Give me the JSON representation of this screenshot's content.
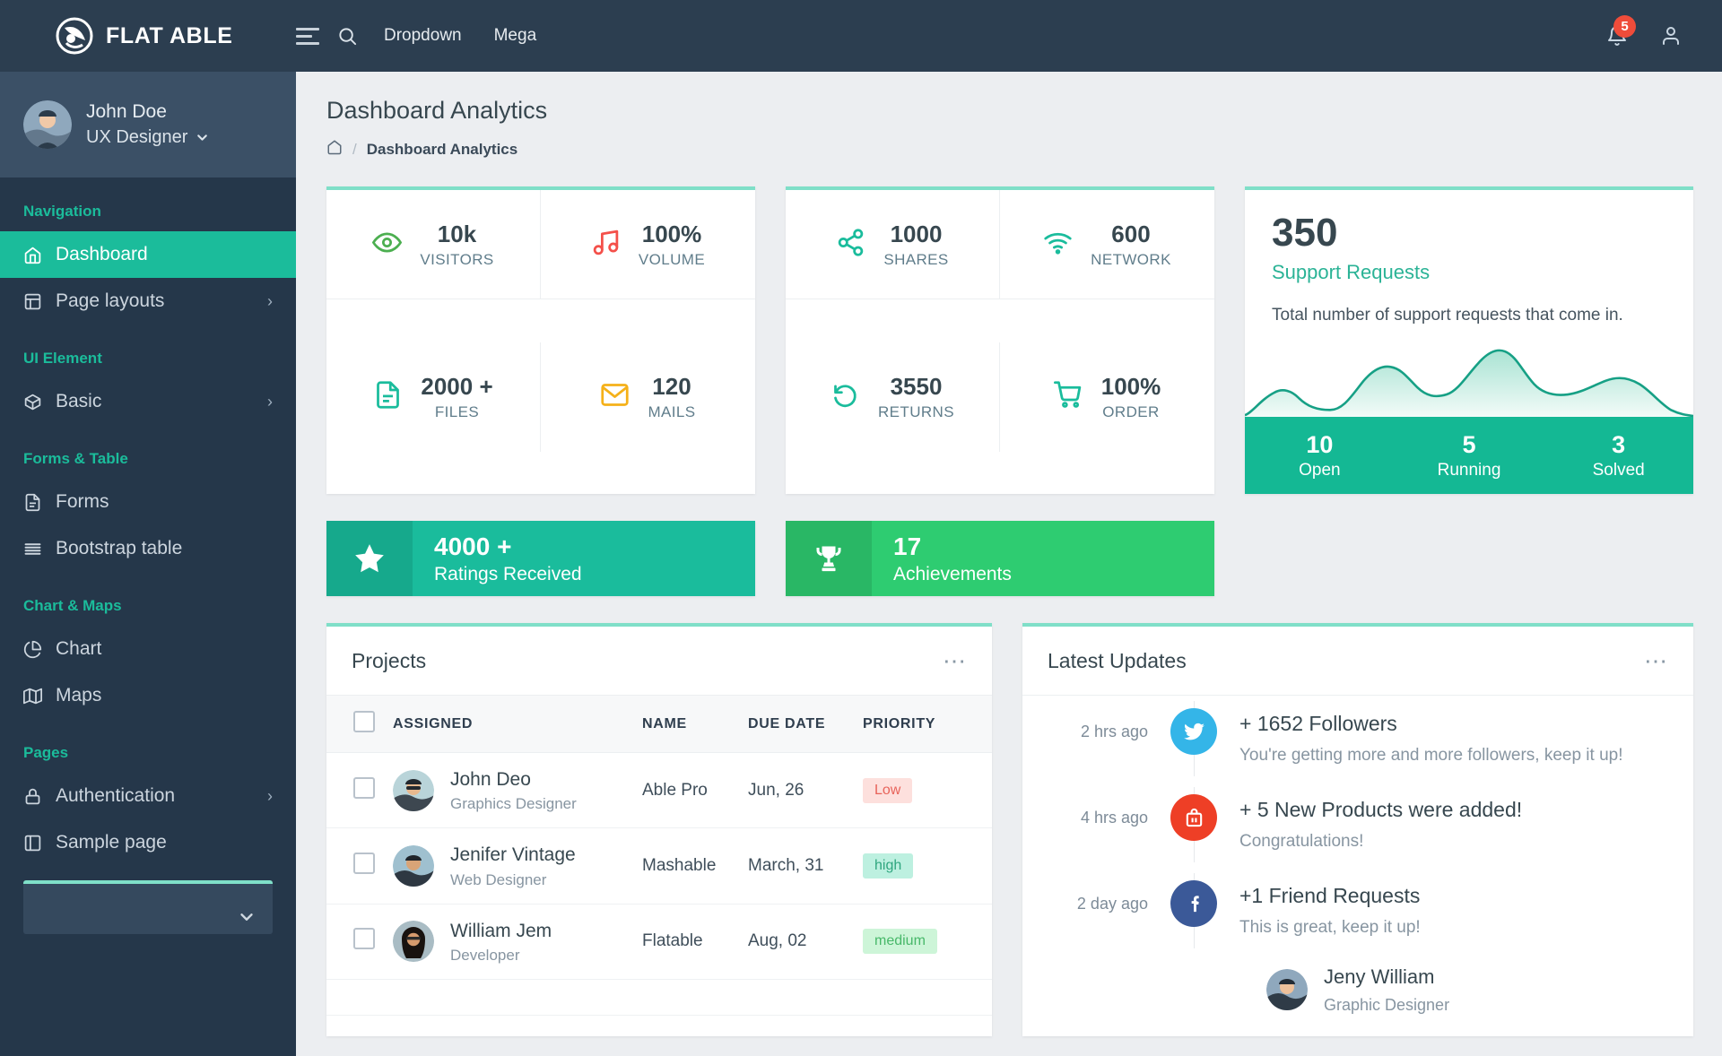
{
  "header": {
    "brand": "FLAT ABLE",
    "logo_icon": "globe-logo-icon",
    "menu_toggle_icon": "hamburger-icon",
    "search_icon": "search-icon",
    "links": [
      {
        "label": "Dropdown"
      },
      {
        "label": "Mega"
      }
    ],
    "notification_icon": "bell-icon",
    "notification_count": "5",
    "profile_icon": "user-icon"
  },
  "sidebar": {
    "user": {
      "name": "John Doe",
      "role": "UX Designer",
      "caret_icon": "chevron-down-icon",
      "avatar_icon": "avatar"
    },
    "groups": [
      {
        "caption": "Navigation",
        "items": [
          {
            "label": "Dashboard",
            "icon": "home-icon",
            "active": true,
            "arrow": ""
          },
          {
            "label": "Page layouts",
            "icon": "layout-icon",
            "active": false,
            "arrow": "›"
          }
        ]
      },
      {
        "caption": "UI Element",
        "items": [
          {
            "label": "Basic",
            "icon": "box-icon",
            "active": false,
            "arrow": "›"
          }
        ]
      },
      {
        "caption": "Forms & Table",
        "items": [
          {
            "label": "Forms",
            "icon": "file-text-icon",
            "active": false,
            "arrow": ""
          },
          {
            "label": "Bootstrap table",
            "icon": "list-icon",
            "active": false,
            "arrow": ""
          }
        ]
      },
      {
        "caption": "Chart & Maps",
        "items": [
          {
            "label": "Chart",
            "icon": "pie-chart-icon",
            "active": false,
            "arrow": ""
          },
          {
            "label": "Maps",
            "icon": "map-icon",
            "active": false,
            "arrow": ""
          }
        ]
      },
      {
        "caption": "Pages",
        "items": [
          {
            "label": "Authentication",
            "icon": "lock-icon",
            "active": false,
            "arrow": "›"
          },
          {
            "label": "Sample page",
            "icon": "sidebar-icon",
            "active": false,
            "arrow": ""
          }
        ]
      }
    ],
    "bottom_card": {
      "caret_icon": "chevron-down-icon"
    }
  },
  "page": {
    "title": "Dashboard Analytics",
    "breadcrumb": {
      "home_icon": "home-icon",
      "separator": "/",
      "current": "Dashboard Analytics"
    }
  },
  "stats_group_1": [
    {
      "value": "10k",
      "label": "VISITORS",
      "icon": "eye-icon",
      "color": "#4caf50"
    },
    {
      "value": "100%",
      "label": "VOLUME",
      "icon": "music-icon",
      "color": "#f4504a"
    },
    {
      "value": "2000 +",
      "label": "FILES",
      "icon": "file-icon",
      "color": "#1abc9c"
    },
    {
      "value": "120",
      "label": "MAILS",
      "icon": "mail-icon",
      "color": "#f5b119"
    }
  ],
  "stats_group_2": [
    {
      "value": "1000",
      "label": "SHARES",
      "icon": "share-icon",
      "color": "#1abc9c"
    },
    {
      "value": "600",
      "label": "NETWORK",
      "icon": "wifi-icon",
      "color": "#1abc9c"
    },
    {
      "value": "3550",
      "label": "RETURNS",
      "icon": "refresh-icon",
      "color": "#1abc9c"
    },
    {
      "value": "100%",
      "label": "ORDER",
      "icon": "cart-icon",
      "color": "#1abc9c"
    }
  ],
  "support": {
    "count": "350",
    "subtitle": "Support Requests",
    "description": "Total number of support requests that come in.",
    "footer": [
      {
        "value": "10",
        "label": "Open"
      },
      {
        "value": "5",
        "label": "Running"
      },
      {
        "value": "3",
        "label": "Solved"
      }
    ]
  },
  "banners": [
    {
      "value": "4000 +",
      "label": "Ratings Received",
      "icon": "star-icon",
      "theme": "teal"
    },
    {
      "value": "17",
      "label": "Achievements",
      "icon": "trophy-icon",
      "theme": "green"
    }
  ],
  "projects": {
    "title": "Projects",
    "menu_icon": "more-horizontal-icon",
    "columns": [
      "ASSIGNED",
      "NAME",
      "DUE DATE",
      "PRIORITY"
    ],
    "rows": [
      {
        "name": "John Deo",
        "role": "Graphics Designer",
        "project": "Able Pro",
        "due": "Jun, 26",
        "priority": "Low",
        "priority_class": "low"
      },
      {
        "name": "Jenifer Vintage",
        "role": "Web Designer",
        "project": "Mashable",
        "due": "March, 31",
        "priority": "high",
        "priority_class": "high"
      },
      {
        "name": "William Jem",
        "role": "Developer",
        "project": "Flatable",
        "due": "Aug, 02",
        "priority": "medium",
        "priority_class": "medium"
      }
    ]
  },
  "latest_updates": {
    "title": "Latest Updates",
    "menu_icon": "more-horizontal-icon",
    "items": [
      {
        "time": "2 hrs ago",
        "icon": "twitter-icon",
        "color": "#34b5e8",
        "title": "+ 1652 Followers",
        "desc": "You're getting more and more followers, keep it up!"
      },
      {
        "time": "4 hrs ago",
        "icon": "briefcase-icon",
        "color": "#ee3f26",
        "title": "+ 5 New Products were added!",
        "desc": "Congratulations!"
      },
      {
        "time": "2 day ago",
        "icon": "facebook-icon",
        "color": "#3b5998",
        "title": "+1 Friend Requests",
        "desc": "This is great, keep it up!"
      }
    ],
    "person": {
      "name": "Jeny William",
      "role": "Graphic Designer",
      "avatar_icon": "avatar"
    }
  },
  "chart_data": {
    "type": "area",
    "title": "Support Requests",
    "xlabel": "",
    "ylabel": "",
    "x": [
      0,
      1,
      2,
      3,
      4,
      5,
      6,
      7,
      8,
      9,
      10,
      11,
      12
    ],
    "values": [
      2,
      26,
      30,
      10,
      8,
      62,
      68,
      40,
      44,
      80,
      86,
      30,
      28,
      48,
      52,
      4
    ],
    "ylim": [
      0,
      100
    ],
    "grid": false,
    "legend": "none",
    "line_color": "#16a085",
    "fill_from": "#a9e3d3",
    "fill_to": "#eaf8f4"
  }
}
